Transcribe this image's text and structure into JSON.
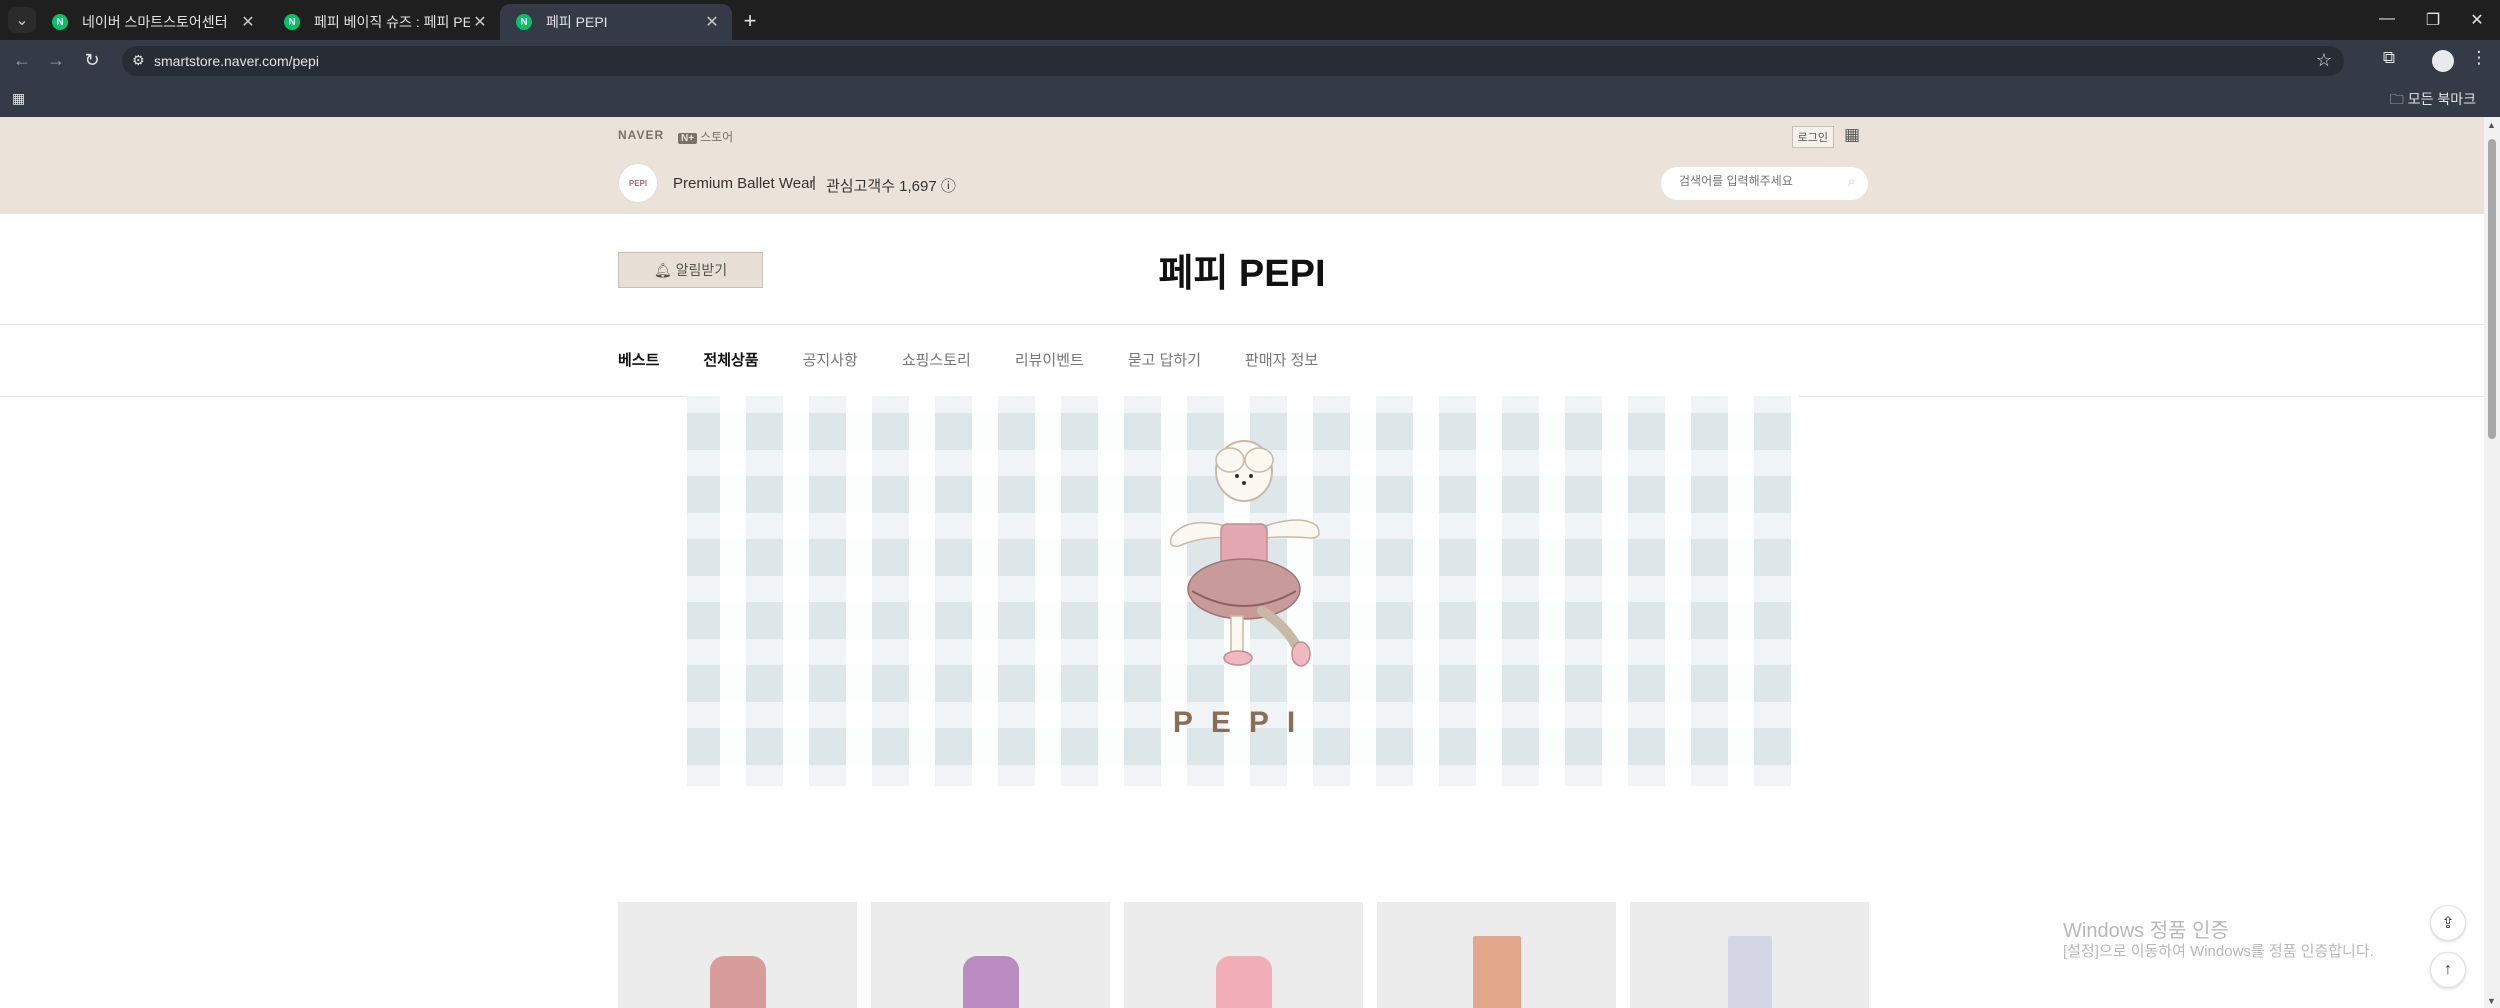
{
  "browser": {
    "tabs": [
      {
        "title": "네이버 스마트스토어센터",
        "active": false
      },
      {
        "title": "페피 베이직 슈즈 : 페피 PEPI",
        "active": false
      },
      {
        "title": "페피 PEPI",
        "active": true
      }
    ],
    "url": "smartstore.naver.com/pepi",
    "bookmarks_all": "모든 북마크"
  },
  "header": {
    "naver": "NAVER",
    "store_badge": "N+",
    "store_label": "스토어",
    "login": "로그인",
    "tagline": "Premium Ballet Wear",
    "separator": "|",
    "followers": "관심고객수 1,697",
    "search_placeholder": "검색어를 입력해주세요"
  },
  "store": {
    "logo_text": "PEPI",
    "alarm_label": "알림받기",
    "name": "페피 PEPI"
  },
  "nav": [
    "베스트",
    "전체상품",
    "공지사항",
    "쇼핑스토리",
    "리뷰이벤트",
    "묻고 답하기",
    "판매자 정보"
  ],
  "banner": {
    "text": "PEPI"
  },
  "products": [
    {
      "color": "#d99c9c"
    },
    {
      "color": "#b98bc0"
    },
    {
      "color": "#f2aeb8"
    },
    {
      "color": "#e3a88c"
    },
    {
      "color": "#d4d6e6"
    }
  ],
  "windows_notice": {
    "line1": "Windows 정품 인증",
    "line2": "[설정]으로 이동하여 Windows를 정품 인증합니다."
  }
}
